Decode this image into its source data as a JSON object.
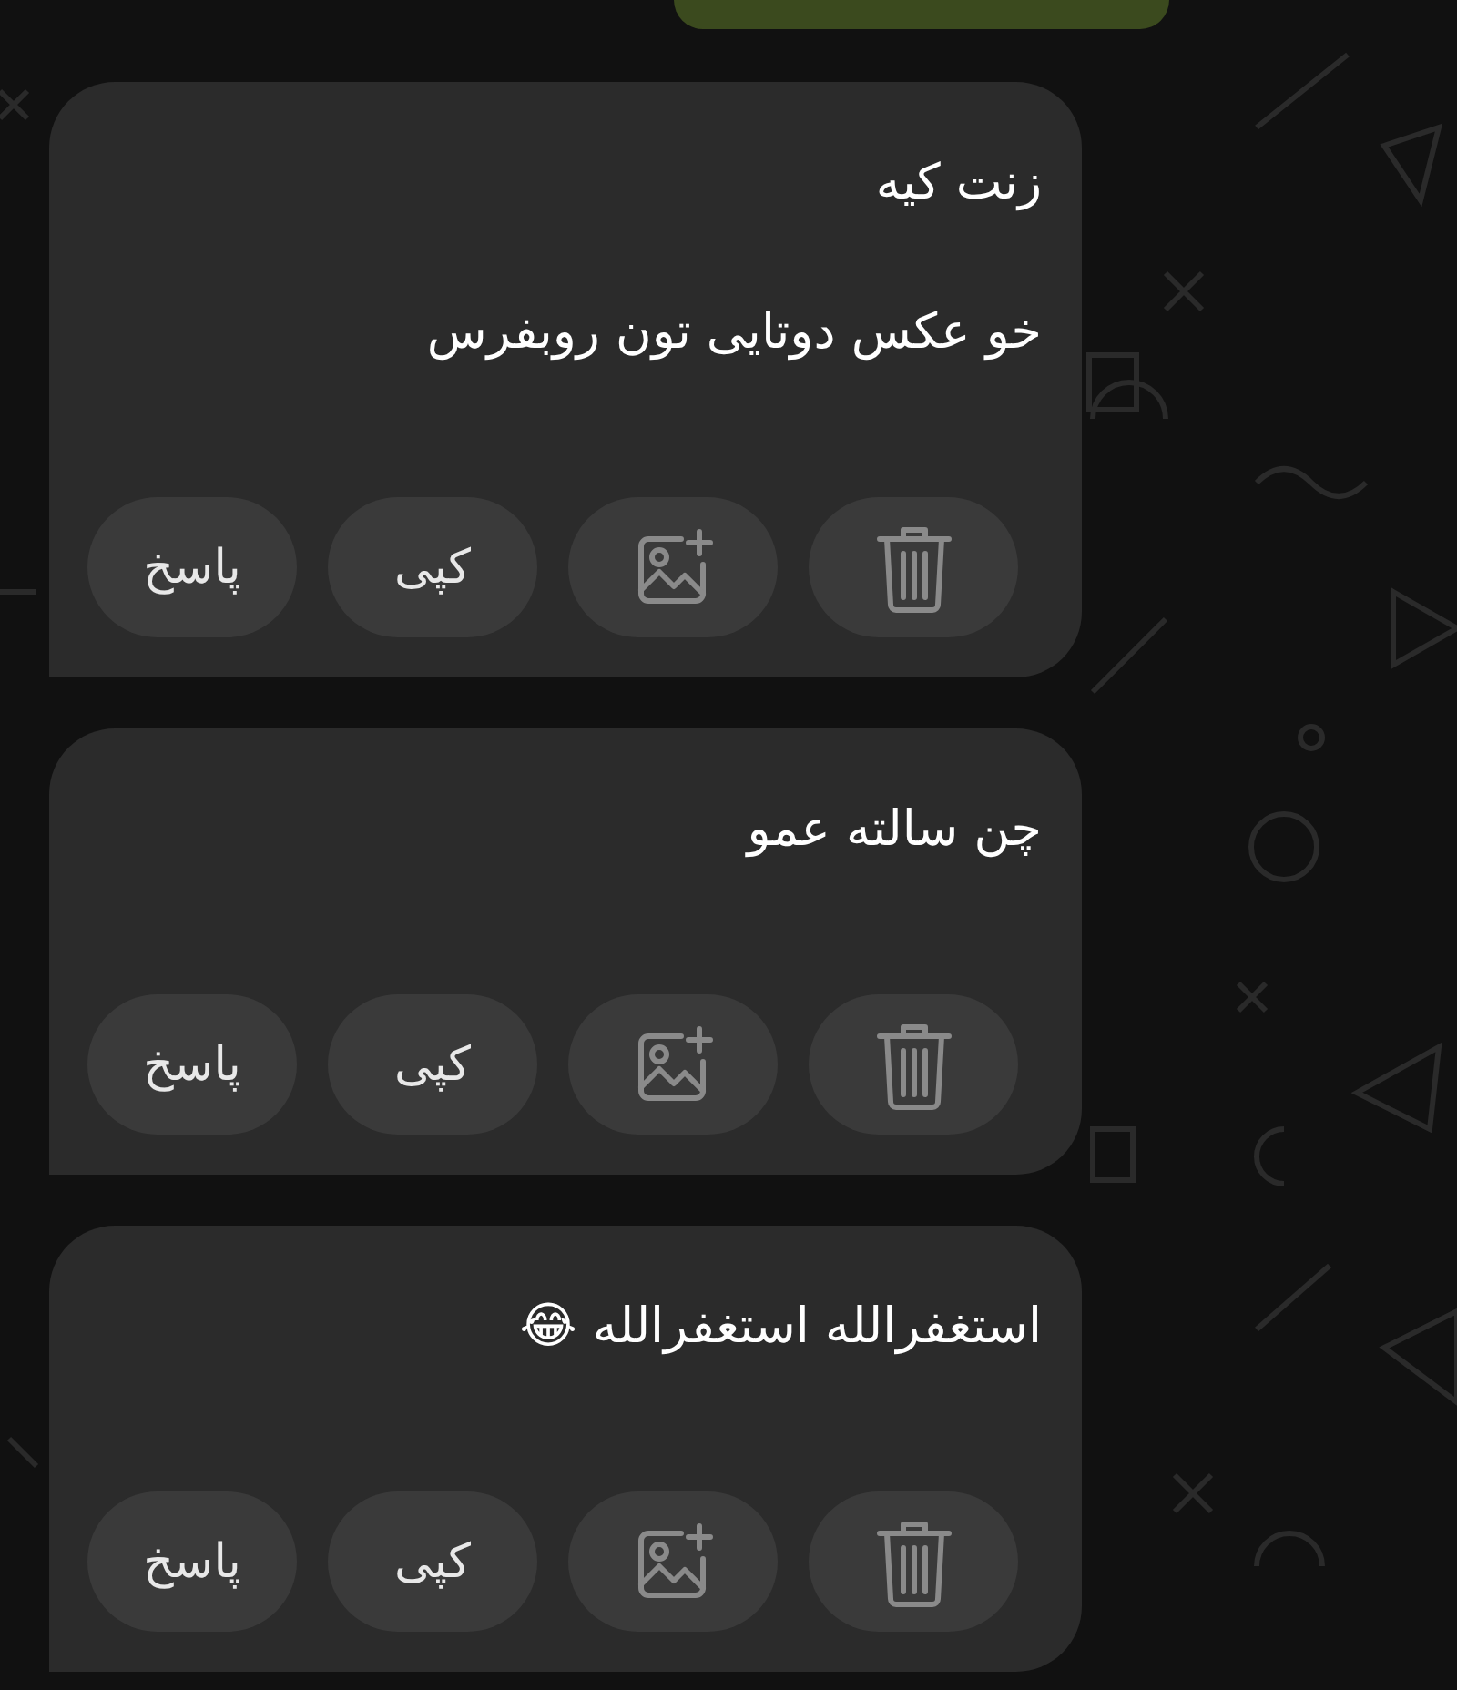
{
  "messages": [
    {
      "lines": [
        "زنت کیه",
        "خو عکس دوتایی تون روبفرس"
      ],
      "actions": [
        {
          "kind": "delete"
        },
        {
          "kind": "add-image"
        },
        {
          "kind": "copy",
          "label": "کپی"
        },
        {
          "kind": "reply",
          "label": "پاسخ"
        }
      ]
    },
    {
      "lines": [
        "چن سالته عمو"
      ],
      "actions": [
        {
          "kind": "delete"
        },
        {
          "kind": "add-image"
        },
        {
          "kind": "copy",
          "label": "کپی"
        },
        {
          "kind": "reply",
          "label": "پاسخ"
        }
      ]
    },
    {
      "lines": [
        "استغفرالله استغفرالله 😂"
      ],
      "actions": [
        {
          "kind": "delete"
        },
        {
          "kind": "add-image"
        },
        {
          "kind": "copy",
          "label": "کپی"
        },
        {
          "kind": "reply",
          "label": "پاسخ"
        }
      ]
    }
  ]
}
